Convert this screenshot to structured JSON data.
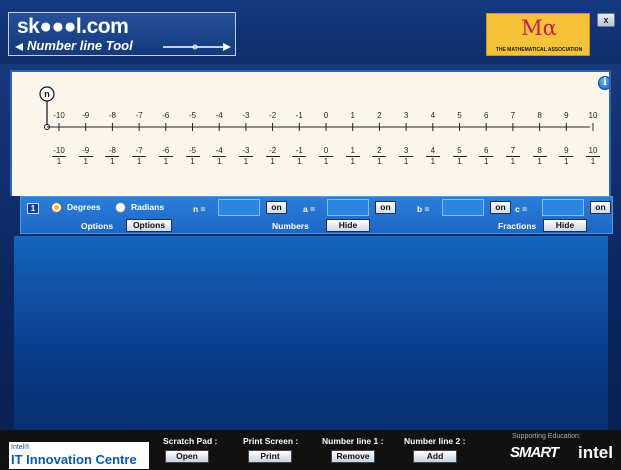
{
  "header": {
    "logo_text": "sk●●●l.com",
    "logo_subtitle": "Number line Tool",
    "partner_symbol": "Mα",
    "partner_name": "THE MATHEMATICAL ASSOCIATION",
    "close_label": "x"
  },
  "number_line": {
    "marker_label": "n",
    "info_label": "i",
    "integers": [
      "-10",
      "-9",
      "-8",
      "-7",
      "-6",
      "-5",
      "-4",
      "-3",
      "-2",
      "-1",
      "0",
      "1",
      "2",
      "3",
      "4",
      "5",
      "6",
      "7",
      "8",
      "9",
      "10"
    ],
    "fraction_numerators": [
      "-10",
      "-9",
      "-8",
      "-7",
      "-6",
      "-5",
      "-4",
      "-3",
      "-2",
      "-1",
      "0",
      "1",
      "2",
      "3",
      "4",
      "5",
      "6",
      "7",
      "8",
      "9",
      "10"
    ],
    "fraction_denominator": "1"
  },
  "controls": {
    "line_number": "1",
    "degrees_label": "Degrees",
    "radians_label": "Radians",
    "options_label": "Options",
    "options_button": "Options",
    "n_label": "n =",
    "n_value": "",
    "n_button": "on",
    "a_label": "a =",
    "a_value": "",
    "a_button": "on",
    "b_label": "b =",
    "b_value": "",
    "b_button": "on",
    "c_label": "c =",
    "c_value": "",
    "c_button": "on",
    "numbers_label": "Numbers",
    "numbers_button": "Hide",
    "fractions_label": "Fractions",
    "fractions_button": "Hide",
    "selected_unit": "Degrees"
  },
  "footer": {
    "intel_small": "Intel®",
    "intel_big": "IT Innovation Centre",
    "scratch_label": "Scratch Pad :",
    "scratch_button": "Open",
    "print_label": "Print Screen :",
    "print_button": "Print",
    "line1_label": "Number line 1 :",
    "line1_button": "Remove",
    "line2_label": "Number line 2 :",
    "line2_button": "Add",
    "support_text": "Supporting Education:",
    "smart_logo": "SMART",
    "intel_logo": "intel"
  },
  "colors": {
    "panel_bg": "#fdf6ec",
    "control_bar": "#1d66c6",
    "workspace": "#0a3d8a",
    "partner_logo": "#f6c23a"
  }
}
